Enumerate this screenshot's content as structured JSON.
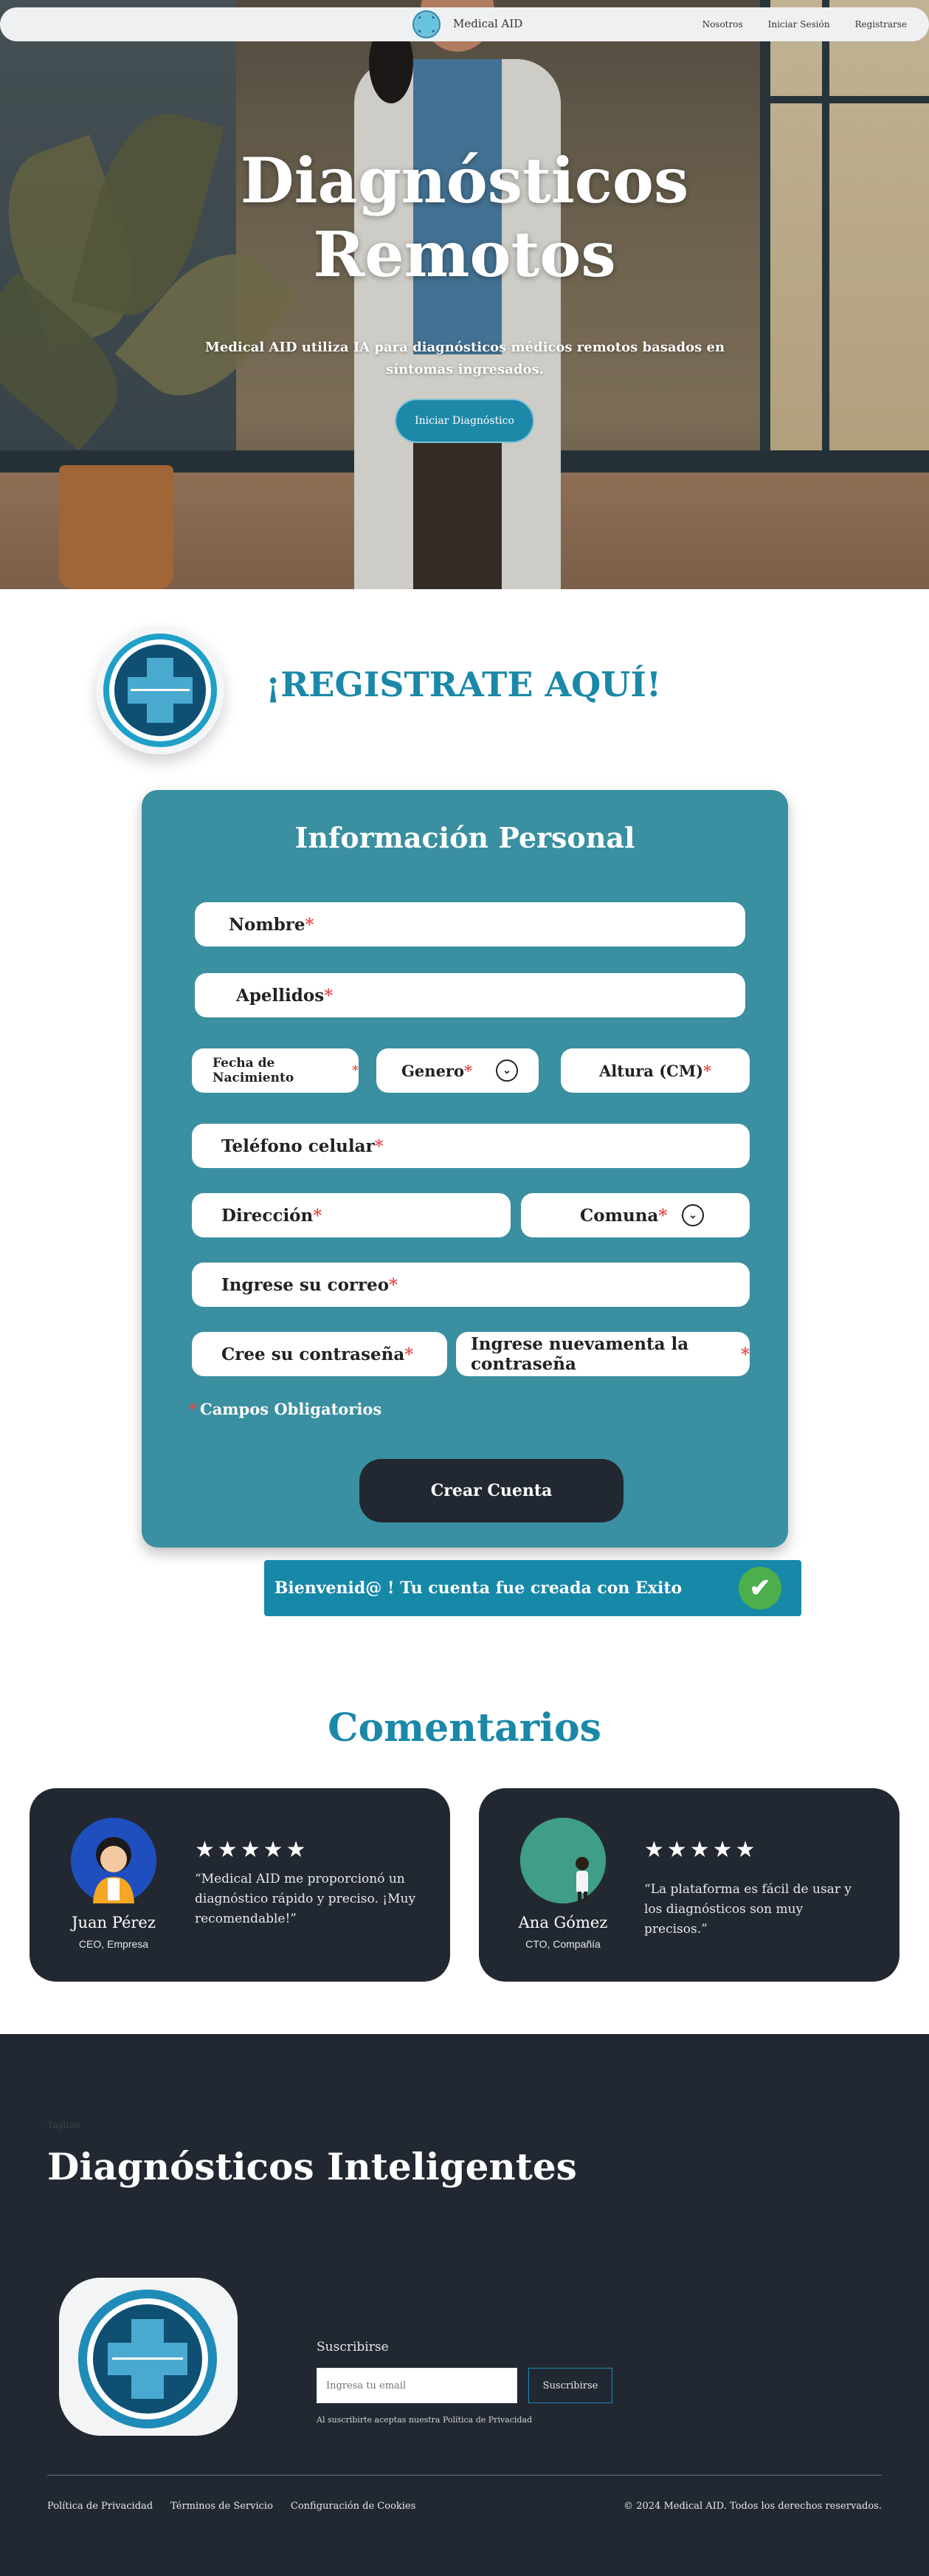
{
  "nav": {
    "brand": "Medical AID",
    "links": [
      "Nosotros",
      "Iniciar Sesión",
      "Registrarse"
    ]
  },
  "hero": {
    "title_line1": "Diagnósticos",
    "title_line2": "Remotos",
    "subtitle": "Medical AID utiliza IA para diagnósticos médicos remotos basados en síntomas ingresados.",
    "button": "Iniciar Diagnóstico"
  },
  "register": {
    "title": "¡REGISTRATE AQUÍ!",
    "form_title": "Información Personal",
    "fields": {
      "nombre": "Nombre",
      "apellidos": "Apellidos",
      "fecha": "Fecha de Nacimiento",
      "genero": "Genero",
      "altura": "Altura (CM)",
      "telefono": "Teléfono celular",
      "direccion": "Dirección",
      "comuna": "Comuna",
      "correo": "Ingrese su correo",
      "password": "Cree su contraseña",
      "password2": "Ingrese nuevamenta la  contraseña"
    },
    "required_mark": "*",
    "legend": "Campos Obligatorios",
    "create_button": "Crear  Cuenta",
    "success_message": "Bienvenid@ ! Tu cuenta fue creada con Exito"
  },
  "comments": {
    "title": "Comentarios",
    "items": [
      {
        "name": "Juan Pérez",
        "role": "CEO, Empresa",
        "stars": "★★★★★",
        "quote": "“Medical AID me proporcionó un diagnóstico rápido y preciso. ¡Muy recomendable!”"
      },
      {
        "name": "Ana Gómez",
        "role": "CTO, Compañía",
        "stars": "★★★★★",
        "quote": "“La plataforma es fácil de usar y los diagnósticos son muy precisos.”"
      }
    ]
  },
  "footer": {
    "tagline": "Tagline",
    "title": "Diagnósticos Inteligentes",
    "subscribe_label": "Suscribirse",
    "email_placeholder": "Ingresa tu email",
    "subscribe_button": "Suscribirse",
    "consent": "Al suscribirte aceptas nuestra Política de Privacidad",
    "links": [
      "Política de Privacidad",
      "Términos de Servicio",
      "Configuración de Cookies"
    ],
    "copyright": "© 2024 Medical AID. Todos los derechos reservados."
  },
  "colors": {
    "accent": "#1a88a8",
    "form_bg": "#3a8fa0",
    "dark": "#222831",
    "required": "#e24b4b",
    "success_check": "#4cae4c"
  },
  "icons": {
    "logo": "medical-cross-circuit-logo",
    "dropdown": "chevron-down-icon",
    "check": "check-circle-icon",
    "star": "star-icon"
  }
}
